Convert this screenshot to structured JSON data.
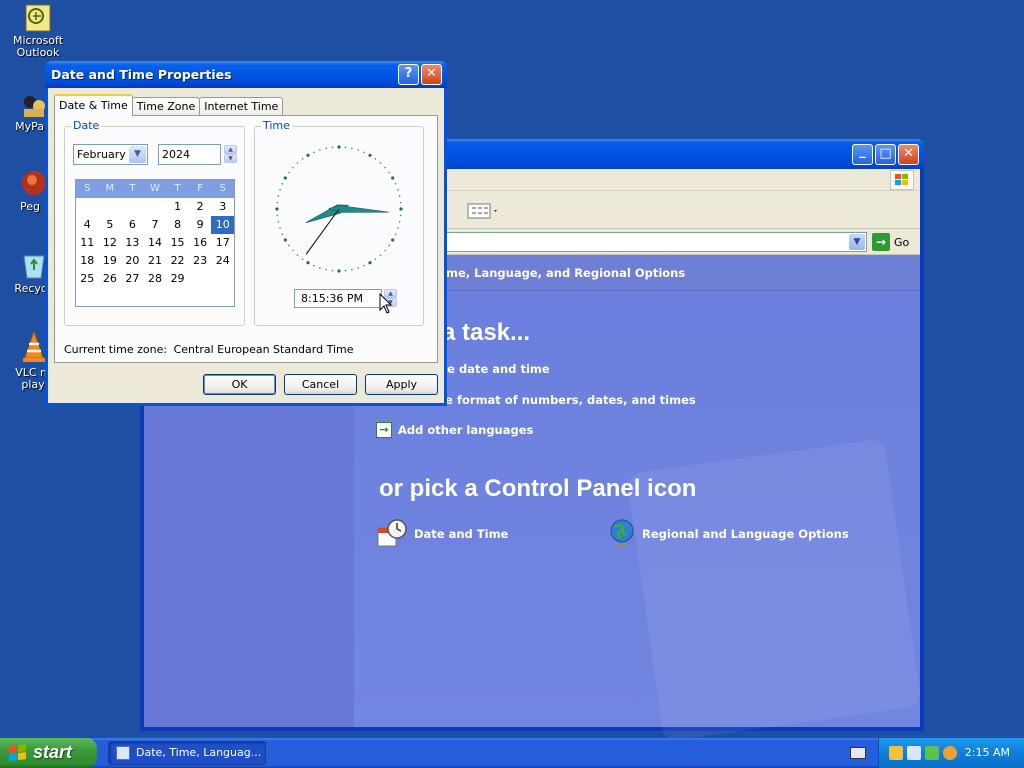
{
  "desktop": {
    "icons": [
      {
        "label": "Microsoft Outlook",
        "icon": "outlook-icon"
      },
      {
        "label": "MyPa",
        "icon": "folder-icon"
      },
      {
        "label": "Peg",
        "icon": "pegasus-icon"
      },
      {
        "label": "Recycl",
        "icon": "recycle-bin-icon"
      },
      {
        "label": "VLC m play",
        "icon": "vlc-icon"
      }
    ]
  },
  "control_panel": {
    "address_go": "Go",
    "category_header": "me, Language, and Regional Options",
    "pick_task": "a task...",
    "tasks": [
      {
        "label": "he date and time"
      },
      {
        "label": "he format of numbers, dates, and times"
      },
      {
        "label": "Add other languages"
      }
    ],
    "pick_icon": "or pick a Control Panel icon",
    "icons": [
      {
        "label": "Date and Time",
        "icon": "date-time-icon"
      },
      {
        "label": "Regional and Language Options",
        "icon": "globe-icon"
      }
    ],
    "window_buttons": {
      "minimize": "_",
      "maximize": "□",
      "close": "✕"
    }
  },
  "dialog": {
    "title": "Date and Time Properties",
    "help_button": "?",
    "close_button": "✕",
    "tabs": [
      {
        "label": "Date & Time",
        "active": true
      },
      {
        "label": "Time Zone",
        "active": false
      },
      {
        "label": "Internet Time",
        "active": false
      }
    ],
    "date_group_label": "Date",
    "month_value": "February",
    "year_value": "2024",
    "calendar": {
      "weekdays": [
        "S",
        "M",
        "T",
        "W",
        "T",
        "F",
        "S"
      ],
      "leading_blanks": 4,
      "days": [
        "1",
        "2",
        "3",
        "4",
        "5",
        "6",
        "7",
        "8",
        "9",
        "10",
        "11",
        "12",
        "13",
        "14",
        "15",
        "16",
        "17",
        "18",
        "19",
        "20",
        "21",
        "22",
        "23",
        "24",
        "25",
        "26",
        "27",
        "28",
        "29"
      ],
      "selected_day": "10"
    },
    "time_group_label": "Time",
    "clock": {
      "hours": 8,
      "minutes": 15,
      "seconds": 36
    },
    "time_value": "8:15:36 PM",
    "time_zone_label": "Current time zone:",
    "time_zone_value": "Central European Standard Time",
    "buttons": {
      "ok": "OK",
      "cancel": "Cancel",
      "apply": "Apply"
    }
  },
  "taskbar": {
    "start_label": "start",
    "task_items": [
      {
        "label": "Date, Time, Languag..."
      }
    ],
    "tray_time": "2:15 AM"
  }
}
